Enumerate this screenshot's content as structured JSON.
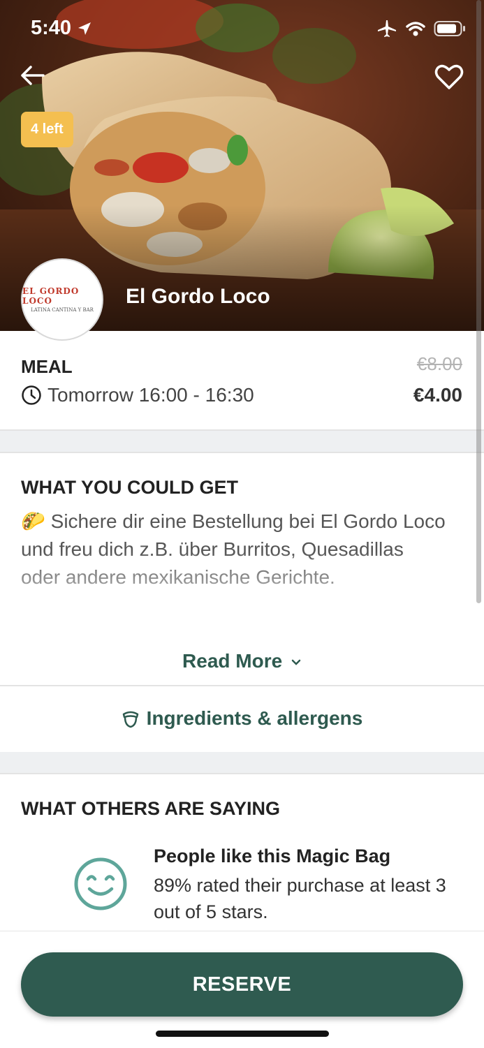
{
  "status_bar": {
    "time": "5:40",
    "icons": [
      "location-arrow-icon",
      "airplane-icon",
      "wifi-icon",
      "battery-icon"
    ]
  },
  "header": {
    "badge": "4 left",
    "store_name": "El Gordo Loco",
    "logo_text": "EL GORDO LOCO",
    "logo_subtext": "LATINA CANTINA Y BAR"
  },
  "summary": {
    "meal_type": "MEAL",
    "pickup": "Tomorrow 16:00 - 16:30",
    "original_price": "€8.00",
    "price": "€4.00"
  },
  "description": {
    "title": "WHAT YOU COULD GET",
    "emoji": "🌮",
    "text": "Sichere dir eine Bestellung bei El Gordo Loco und freu dich z.B. über Burritos, Quesadillas oder andere mexikanische Gerichte.",
    "read_more": "Read More"
  },
  "ingredients": {
    "label": "Ingredients & allergens"
  },
  "reviews": {
    "title": "WHAT OTHERS ARE SAYING",
    "headline": "People like this Magic Bag",
    "text": "89% rated their purchase at least 3 out of 5 stars."
  },
  "actions": {
    "reserve": "RESERVE"
  },
  "colors": {
    "brand_green": "#2f5b50",
    "badge_yellow": "#f4bf50",
    "smiley_teal": "#5ea69a",
    "section_gap": "#eef0f2"
  }
}
